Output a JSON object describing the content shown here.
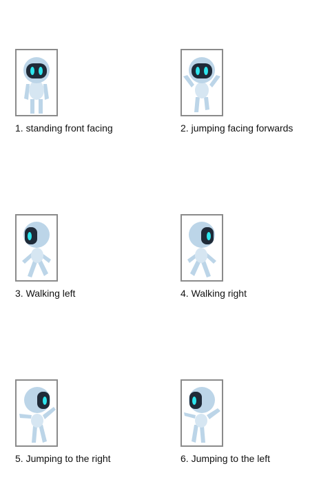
{
  "colors": {
    "frame_border": "#8a8a8a",
    "robot_body": "#bcd5e8",
    "robot_belly": "#d6e6f2",
    "robot_visor": "#1f2a38",
    "robot_eye": "#2ee6ee"
  },
  "sprites": [
    {
      "number": "1.",
      "label": "standing front facing",
      "pose": "stand-front"
    },
    {
      "number": "2.",
      "label": "jumping facing forwards",
      "pose": "jump-front"
    },
    {
      "number": "3.",
      "label": "Walking left",
      "pose": "walk-left"
    },
    {
      "number": "4.",
      "label": "Walking right",
      "pose": "walk-right"
    },
    {
      "number": "5.",
      "label": "Jumping to the right",
      "pose": "jump-right"
    },
    {
      "number": "6.",
      "label": "Jumping to the left",
      "pose": "jump-left"
    }
  ]
}
